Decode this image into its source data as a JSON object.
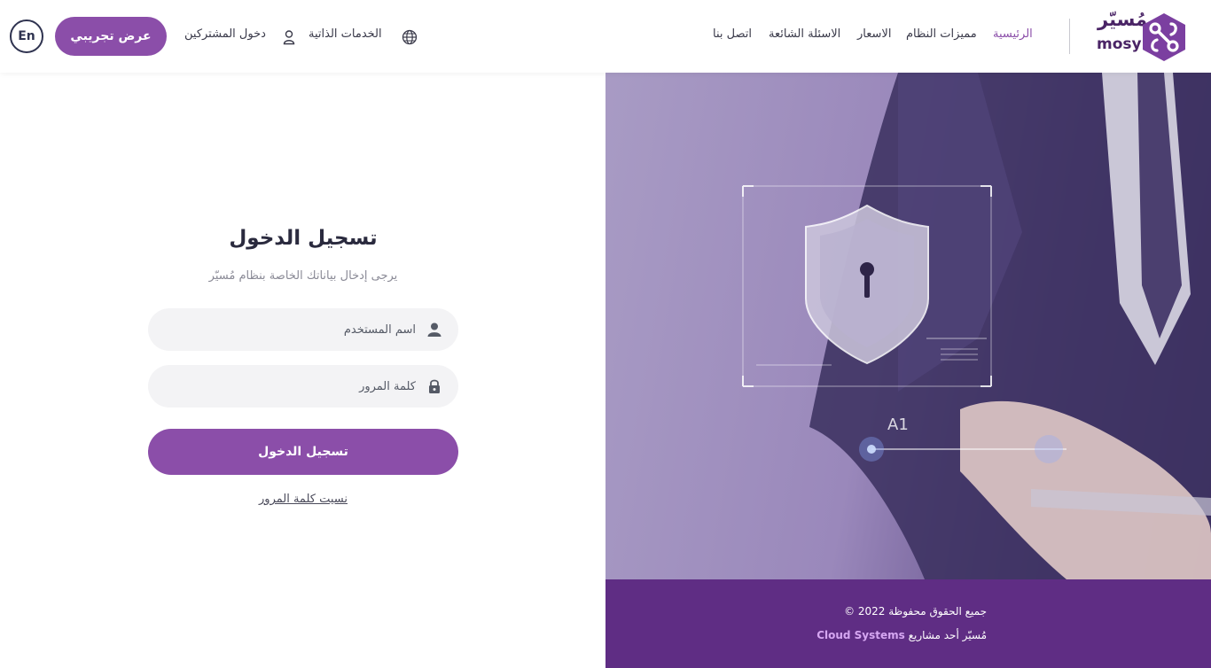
{
  "header": {
    "lang_button": "En",
    "demo_button": "عرض تجريبي",
    "subscribers_login": "دخول المشتركين",
    "self_services": "الخدمات الذاتية",
    "nav": [
      {
        "label": "الرئيسية",
        "active": true
      },
      {
        "label": "مميزات النظام",
        "active": false
      },
      {
        "label": "الاسعار",
        "active": false
      },
      {
        "label": "الاسئلة الشائعة",
        "active": false
      },
      {
        "label": "اتصل بنا",
        "active": false
      }
    ],
    "logo_ar": "مُسيّر",
    "logo_en": "mosyr"
  },
  "login": {
    "title": "تسجيل الدخول",
    "subtitle": "يرجى إدخال بياناتك الخاصة بنظام مُسيّر",
    "username_placeholder": "اسم المستخدم",
    "password_placeholder": "كلمة المرور",
    "submit": "تسجيل الدخول",
    "forgot": "نسيت كلمة المرور"
  },
  "hero": {
    "label": "A1"
  },
  "footer": {
    "copyright": "جميع الحقوق محفوظة 2022 ©",
    "credit_prefix": "مُسيّر أحد مشاريع",
    "credit_brand": "Cloud Systems"
  },
  "colors": {
    "accent": "#8b4ea9",
    "footer_bg": "#5f2d84",
    "text_dark": "#2a2a3e"
  }
}
